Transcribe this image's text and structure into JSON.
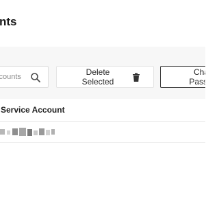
{
  "header": {
    "title": "nts"
  },
  "toolbar": {
    "search_placeholder": "ccounts",
    "delete_label_line1": "Delete",
    "delete_label_line2": "Selected",
    "change_label_line1": "Cha",
    "change_label_line2": "Passw"
  },
  "table": {
    "columns": [
      "Service Account"
    ],
    "rows": [
      {
        "service_account": "[redacted]"
      }
    ]
  },
  "icons": {
    "search": "search-icon",
    "delete": "trash-icon"
  },
  "colors": {
    "header_bg": "#ffffff",
    "toolbar_bg": "#f7f7f7",
    "button_border": "#e5e5e5",
    "primary_outline": "#3a3a3a",
    "redacted_gray": "#8c8c8c"
  }
}
